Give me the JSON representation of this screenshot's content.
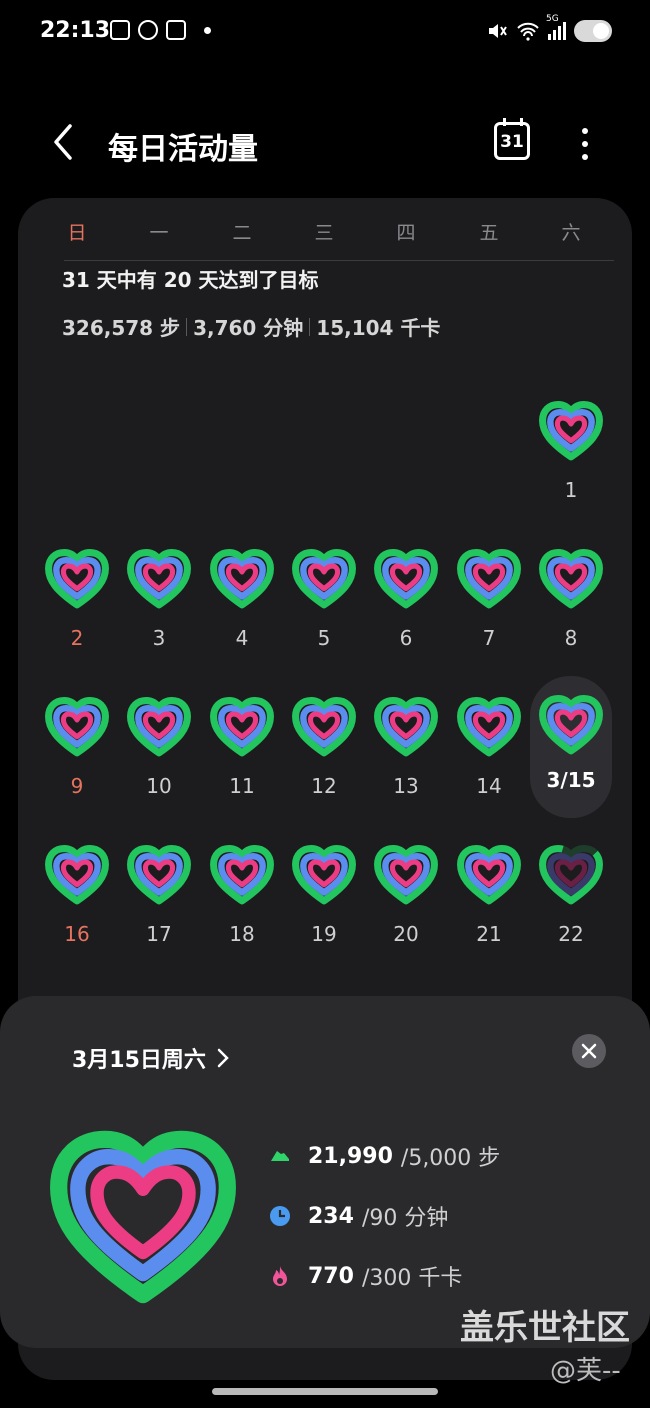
{
  "status_bar": {
    "time": "22:13",
    "left_icons": [
      "image-icon",
      "wechat-icon",
      "copy-icon",
      "dot"
    ],
    "right_icons": [
      "mute-icon",
      "wifi-icon",
      "signal-5g-icon",
      "battery-icon"
    ],
    "signal_label": "5G"
  },
  "header": {
    "title": "每日活动量",
    "calendar_label": "31"
  },
  "calendar": {
    "weekdays": [
      "日",
      "一",
      "二",
      "三",
      "四",
      "五",
      "六"
    ],
    "summary": "31 天中有 20 天达到了目标",
    "stats": {
      "steps": "326,578 步",
      "minutes": "3,760 分钟",
      "calories": "15,104 千卡"
    },
    "days": [
      {
        "label": "1",
        "col": 6,
        "row": 0
      },
      {
        "label": "2",
        "col": 0,
        "row": 1
      },
      {
        "label": "3",
        "col": 1,
        "row": 1
      },
      {
        "label": "4",
        "col": 2,
        "row": 1
      },
      {
        "label": "5",
        "col": 3,
        "row": 1
      },
      {
        "label": "6",
        "col": 4,
        "row": 1
      },
      {
        "label": "7",
        "col": 5,
        "row": 1
      },
      {
        "label": "8",
        "col": 6,
        "row": 1
      },
      {
        "label": "9",
        "col": 0,
        "row": 2
      },
      {
        "label": "10",
        "col": 1,
        "row": 2
      },
      {
        "label": "11",
        "col": 2,
        "row": 2
      },
      {
        "label": "12",
        "col": 3,
        "row": 2
      },
      {
        "label": "13",
        "col": 4,
        "row": 2
      },
      {
        "label": "14",
        "col": 5,
        "row": 2
      },
      {
        "label": "3/15",
        "col": 6,
        "row": 2,
        "selected": true
      },
      {
        "label": "16",
        "col": 0,
        "row": 3
      },
      {
        "label": "17",
        "col": 1,
        "row": 3
      },
      {
        "label": "18",
        "col": 2,
        "row": 3
      },
      {
        "label": "19",
        "col": 3,
        "row": 3
      },
      {
        "label": "20",
        "col": 4,
        "row": 3
      },
      {
        "label": "21",
        "col": 5,
        "row": 3
      },
      {
        "label": "22",
        "col": 6,
        "row": 3,
        "partial": true
      }
    ]
  },
  "detail_sheet": {
    "date": "3月15日周六",
    "metrics": [
      {
        "icon": "shoe-icon",
        "value": "21,990",
        "goal": "/5,000 步",
        "color": "#2fd36a"
      },
      {
        "icon": "clock-icon",
        "value": "234",
        "goal": "/90 分钟",
        "color": "#4a9bf0"
      },
      {
        "icon": "flame-icon",
        "value": "770",
        "goal": "/300 千卡",
        "color": "#f0559a"
      }
    ]
  },
  "watermark": {
    "brand": "盖乐世社区",
    "user": "@芙--"
  },
  "colors": {
    "ring_outer": "#22c55e",
    "ring_middle": "#5b8def",
    "ring_inner": "#ec3c83",
    "sunday": "#e5735f"
  }
}
